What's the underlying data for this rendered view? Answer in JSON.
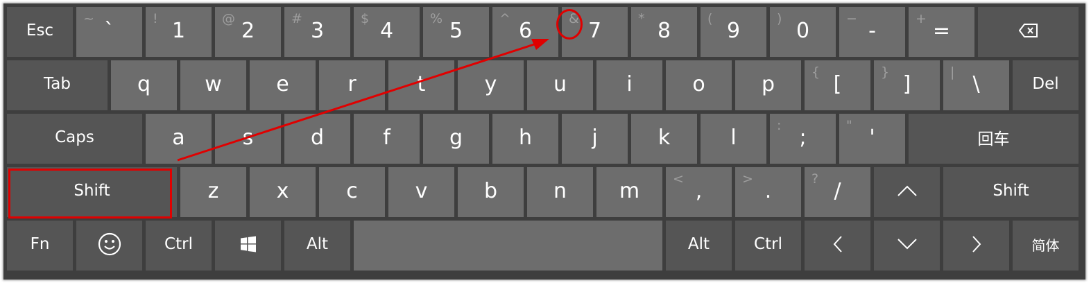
{
  "colors": {
    "frame": "#3e3e3e",
    "key_function": "#555555",
    "key_char": "#6d6d6d",
    "text": "#ffffff",
    "secondary_text": "#9e9e9e",
    "annotation": "#e00000"
  },
  "row1": {
    "esc": "Esc",
    "keys": [
      {
        "main": "`",
        "sec": "~"
      },
      {
        "main": "1",
        "sec": "!"
      },
      {
        "main": "2",
        "sec": "@"
      },
      {
        "main": "3",
        "sec": "#"
      },
      {
        "main": "4",
        "sec": "$"
      },
      {
        "main": "5",
        "sec": "%"
      },
      {
        "main": "6",
        "sec": "^"
      },
      {
        "main": "7",
        "sec": "&"
      },
      {
        "main": "8",
        "sec": "*"
      },
      {
        "main": "9",
        "sec": "("
      },
      {
        "main": "0",
        "sec": ")"
      },
      {
        "main": "-",
        "sec": "−"
      },
      {
        "main": "=",
        "sec": "+"
      }
    ],
    "backspace_icon": "backspace-icon"
  },
  "row2": {
    "tab": "Tab",
    "keys": [
      {
        "main": "q"
      },
      {
        "main": "w"
      },
      {
        "main": "e"
      },
      {
        "main": "r"
      },
      {
        "main": "t"
      },
      {
        "main": "y"
      },
      {
        "main": "u"
      },
      {
        "main": "i"
      },
      {
        "main": "o"
      },
      {
        "main": "p"
      },
      {
        "main": "[",
        "sec": "{"
      },
      {
        "main": "]",
        "sec": "}"
      },
      {
        "main": "\\",
        "sec": "|"
      }
    ],
    "del": "Del"
  },
  "row3": {
    "caps": "Caps",
    "keys": [
      {
        "main": "a"
      },
      {
        "main": "s"
      },
      {
        "main": "d"
      },
      {
        "main": "f"
      },
      {
        "main": "g"
      },
      {
        "main": "h"
      },
      {
        "main": "j"
      },
      {
        "main": "k"
      },
      {
        "main": "l"
      },
      {
        "main": ";",
        "sec": ":"
      },
      {
        "main": "'",
        "sec": "\""
      }
    ],
    "enter": "回车"
  },
  "row4": {
    "shift_left": "Shift",
    "keys": [
      {
        "main": "z"
      },
      {
        "main": "x"
      },
      {
        "main": "c"
      },
      {
        "main": "v"
      },
      {
        "main": "b"
      },
      {
        "main": "n"
      },
      {
        "main": "m"
      },
      {
        "main": ",",
        "sec": "<"
      },
      {
        "main": ".",
        "sec": ">"
      },
      {
        "main": "/",
        "sec": "?"
      }
    ],
    "up_icon": "arrow-up-icon",
    "shift_right": "Shift"
  },
  "row5": {
    "fn": "Fn",
    "emoji_icon": "emoji-icon",
    "ctrl_left": "Ctrl",
    "windows_icon": "windows-icon",
    "alt_left": "Alt",
    "alt_right": "Alt",
    "ctrl_right": "Ctrl",
    "left_icon": "arrow-left-icon",
    "down_icon": "arrow-down-icon",
    "right_icon": "arrow-right-icon",
    "lang": "简体"
  }
}
